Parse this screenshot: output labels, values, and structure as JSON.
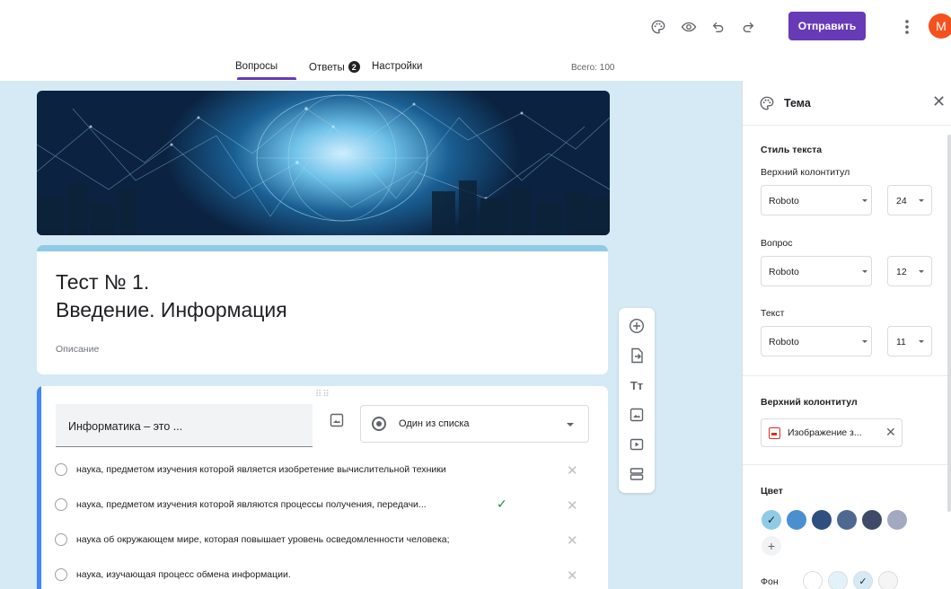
{
  "toolbar": {
    "send_label": "Отправить",
    "avatar_letter": "M",
    "icons": [
      "palette-icon",
      "eye-icon",
      "undo-icon",
      "redo-icon",
      "more-vert-icon"
    ]
  },
  "tabs": {
    "questions": "Вопросы",
    "answers": "Ответы",
    "answers_count": "2",
    "settings": "Настройки",
    "total": "Всего: 100"
  },
  "form": {
    "title_line1": "Тест № 1.",
    "title_line2": "Введение. Информация",
    "description_placeholder": "Описание"
  },
  "question": {
    "text": "Информатика – это ...",
    "type": "Один из списка",
    "options": [
      {
        "text": "наука, предметом изучения которой является изобретение вычислительной техники",
        "correct": false
      },
      {
        "text": "наука, предметом изучения которой являются процессы получения, передачи...",
        "correct": true
      },
      {
        "text": "наука об окружающем мире, которая повышает уровень осведомленности человека;",
        "correct": false
      },
      {
        "text": "наука, изучающая процесс обмена информации.",
        "correct": false
      }
    ]
  },
  "theme": {
    "title": "Тема",
    "text_style": "Стиль текста",
    "header_label": "Верхний колонтитул",
    "header_font": "Roboto",
    "header_size": "24",
    "question_label": "Вопрос",
    "question_font": "Roboto",
    "question_size": "12",
    "text_label": "Текст",
    "text_font": "Roboto",
    "text_size": "11",
    "header_section": "Верхний колонтитул",
    "header_image": "Изображение з...",
    "color_section": "Цвет",
    "colors": [
      "#8fcbe6",
      "#4a90d0",
      "#2f4f7f",
      "#4f6890",
      "#3e4a66",
      "#a2a9c0"
    ],
    "selected_color_index": 0,
    "background_label": "Фон",
    "background_colors": [
      "#ffffff",
      "#e3f2f9",
      "#d5eaf4",
      "#f5f5f5"
    ],
    "selected_background_index": 2
  }
}
